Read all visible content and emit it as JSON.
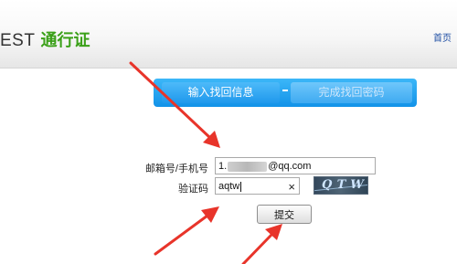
{
  "header": {
    "brand_prefix": "EST",
    "brand_suffix": "通行证",
    "home_link": "首页"
  },
  "steps": [
    {
      "label": "输入找回信息",
      "active": true
    },
    {
      "label": "完成找回密码",
      "active": false
    }
  ],
  "form": {
    "account_label": "邮箱号/手机号",
    "account_value_prefix": "1.",
    "account_value_suffix": "@qq.com",
    "captcha_label": "验证码",
    "captcha_value": "aqtw",
    "clear_icon": "×",
    "captcha_image_text": "QTW",
    "submit_label": "提交"
  },
  "colors": {
    "brand_green": "#3aa018",
    "step_blue": "#1292e8",
    "annotation_red": "#e8342a"
  },
  "annotations": {
    "arrow_count": 4
  }
}
